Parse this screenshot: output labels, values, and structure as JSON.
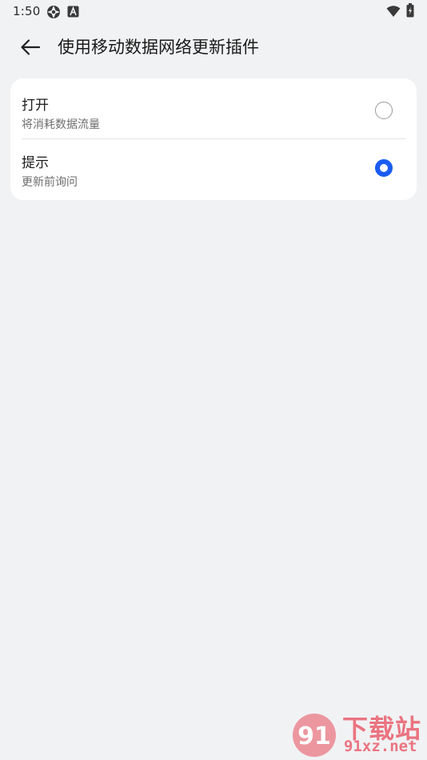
{
  "status_bar": {
    "time": "1:50",
    "left_icons": [
      "browser-app-icon",
      "a-badge-icon"
    ],
    "right_icons": [
      "wifi-icon",
      "battery-icon"
    ]
  },
  "app_bar": {
    "back_icon": "arrow-left-icon",
    "title": "使用移动数据网络更新插件"
  },
  "options": [
    {
      "title": "打开",
      "subtitle": "将消耗数据流量",
      "selected": false
    },
    {
      "title": "提示",
      "subtitle": "更新前询问",
      "selected": true
    }
  ],
  "watermark": {
    "brand": "下载站",
    "domain": "91xz.net",
    "logo_text": "91"
  },
  "colors": {
    "background": "#f1f2f4",
    "card": "#ffffff",
    "accent": "#1a5cf0",
    "watermark": "#e84b5a"
  }
}
